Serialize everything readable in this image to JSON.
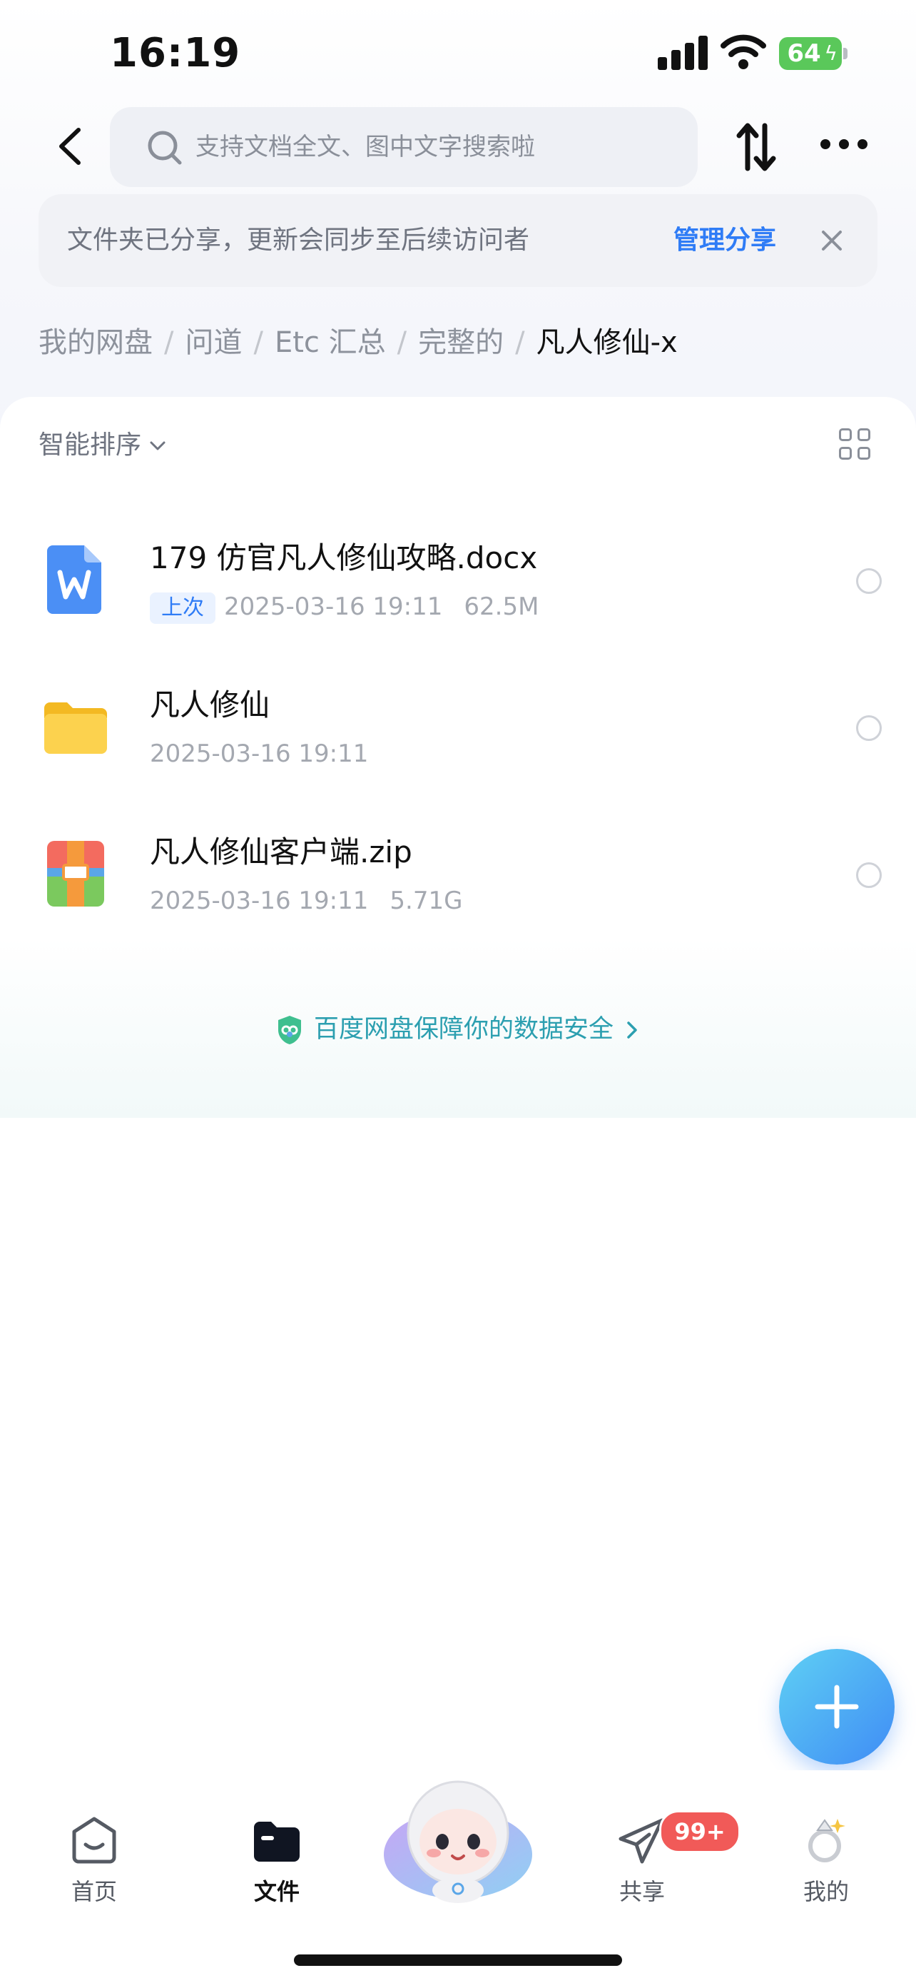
{
  "status": {
    "time": "16:19",
    "battery": "64"
  },
  "header": {
    "search_placeholder": "支持文档全文、图中文字搜索啦"
  },
  "banner": {
    "message": "文件夹已分享，更新会同步至后续访问者",
    "manage": "管理分享"
  },
  "breadcrumb": [
    "我的网盘",
    "问道",
    "Etc 汇总",
    "完整的",
    "凡人修仙-x"
  ],
  "sort": {
    "label": "智能排序"
  },
  "files": [
    {
      "name": "179 仿官凡人修仙攻略.docx",
      "tag": "上次",
      "date": "2025-03-16 19:11",
      "size": "62.5M",
      "icon": "word-doc-icon"
    },
    {
      "name": "凡人修仙",
      "date": "2025-03-16 19:11",
      "icon": "folder-icon"
    },
    {
      "name": "凡人修仙客户端.zip",
      "date": "2025-03-16 19:11",
      "size": "5.71G",
      "icon": "zip-archive-icon"
    }
  ],
  "safety_notice": "百度网盘保障你的数据安全",
  "nav": {
    "home": "首页",
    "files": "文件",
    "share": "共享",
    "share_badge": "99+",
    "mine": "我的"
  },
  "colors": {
    "accent": "#2f7cf6",
    "badge": "#f15a58",
    "safe_text": "#2c9fb0"
  }
}
